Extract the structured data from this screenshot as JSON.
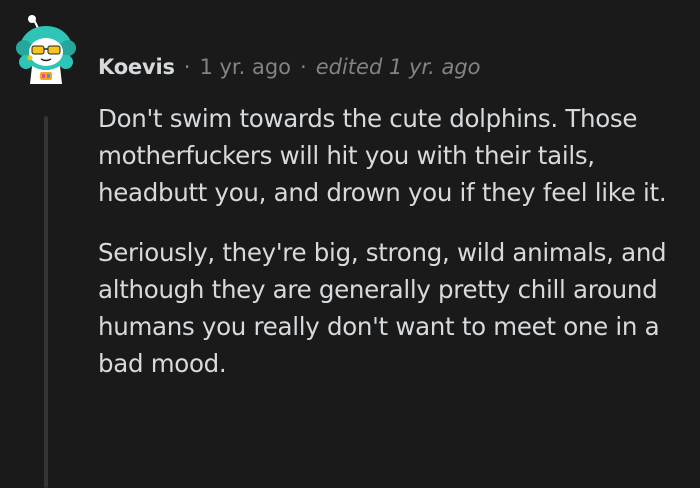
{
  "comment": {
    "author": "Koevis",
    "separator": "·",
    "timestamp": "1 yr. ago",
    "edited": "edited 1 yr. ago",
    "paragraphs": [
      "Don't swim towards the cute dolphins. Those motherfuckers will hit you with their tails, headbutt you, and drown you if they feel like it.",
      "Seriously, they're big, strong, wild animals, and although they are generally pretty chill around humans you really don't want to meet one in a bad mood."
    ]
  },
  "colors": {
    "background": "#1a1a1b",
    "text": "#d7dadc",
    "meta": "#818384",
    "thread_line": "#343536",
    "avatar_hair": "#2ec4b6",
    "avatar_glasses": "#f5c518"
  },
  "icons": {
    "avatar": "snoo-avatar-icon"
  }
}
